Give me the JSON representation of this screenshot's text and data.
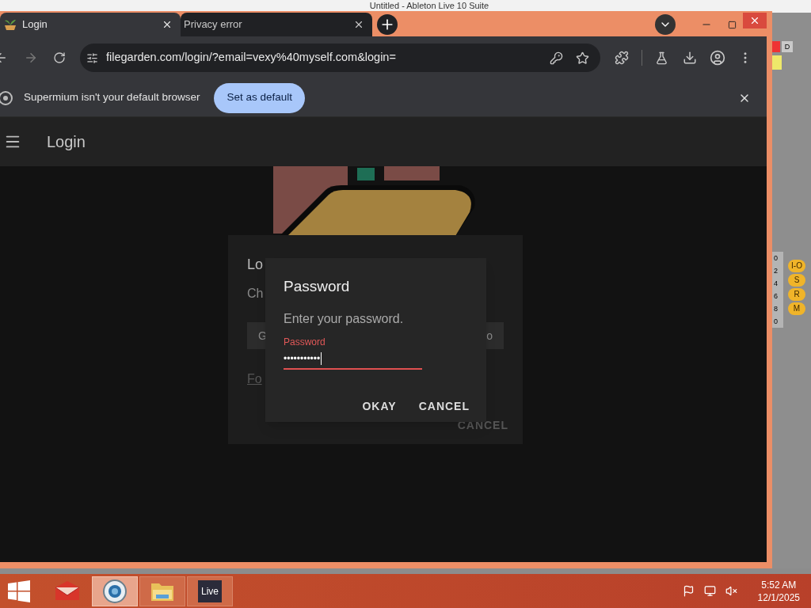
{
  "background_window": {
    "title": "Untitled - Ableton Live 10 Suite",
    "side_label": "D",
    "scale": [
      "0",
      "2",
      "4",
      "6",
      "8",
      "0"
    ],
    "buttons": [
      {
        "label": "I-O"
      },
      {
        "label": "S"
      },
      {
        "label": "R"
      },
      {
        "label": "M"
      }
    ]
  },
  "browser": {
    "tabs": [
      {
        "label": "Login",
        "selected": true
      },
      {
        "label": "Privacy error",
        "selected": false
      }
    ],
    "address": "filegarden.com/login/?email=vexy%40myself.com&login=",
    "infobar": {
      "message": "Supermium isn't your default browser",
      "button": "Set as default"
    }
  },
  "page": {
    "header_title": "Login",
    "login_card": {
      "title": "Lo",
      "subtitle": "Ch",
      "field_start": "G",
      "field_end": "o",
      "link": "Fo",
      "button": "CANCEL"
    },
    "dialog": {
      "title": "Password",
      "message": "Enter your password.",
      "field": {
        "label": "Password",
        "value": "•••••••••••",
        "error": true
      },
      "buttons": [
        "OKAY",
        "CANCEL"
      ]
    }
  },
  "taskbar": {
    "apps": [
      {
        "kind": "mail",
        "selected": false
      },
      {
        "kind": "browser",
        "selected": true
      },
      {
        "kind": "folder",
        "selected": false
      },
      {
        "kind": "live",
        "label": "Live",
        "selected": false
      }
    ],
    "time": "5:52 AM",
    "date": "12/1/2025"
  }
}
